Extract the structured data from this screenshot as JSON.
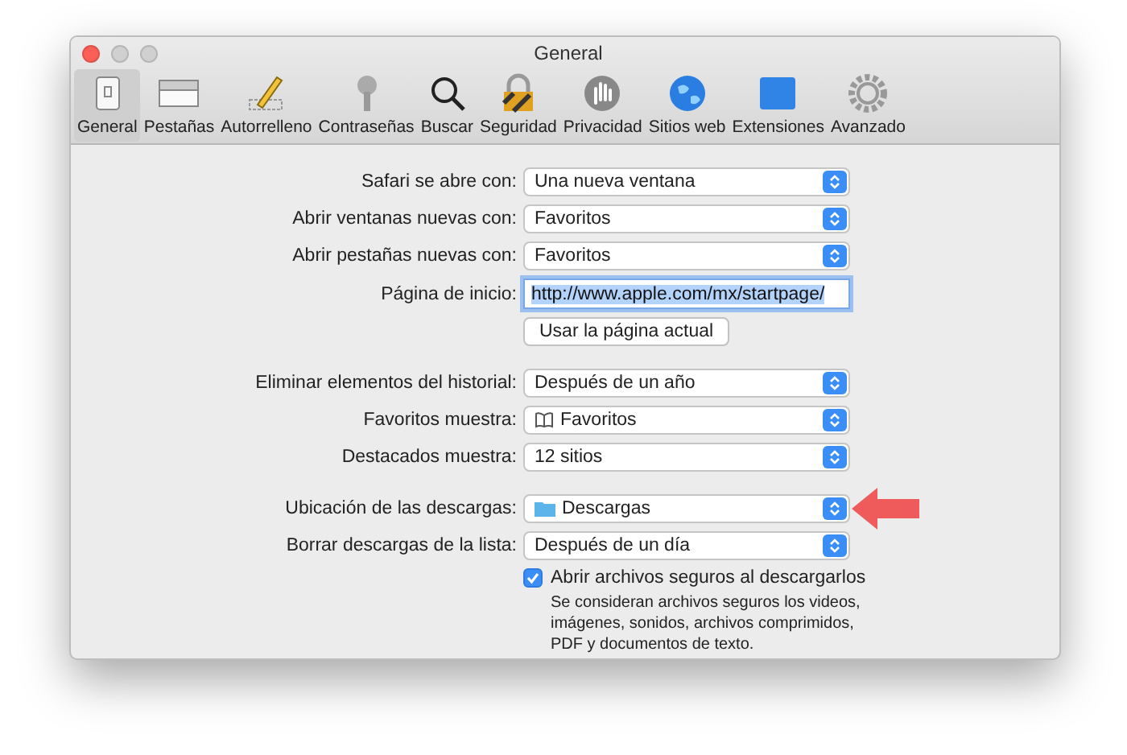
{
  "window": {
    "title": "General"
  },
  "toolbar": [
    {
      "label": "General",
      "selected": true
    },
    {
      "label": "Pestañas",
      "selected": false
    },
    {
      "label": "Autorrelleno",
      "selected": false
    },
    {
      "label": "Contraseñas",
      "selected": false
    },
    {
      "label": "Buscar",
      "selected": false
    },
    {
      "label": "Seguridad",
      "selected": false
    },
    {
      "label": "Privacidad",
      "selected": false
    },
    {
      "label": "Sitios web",
      "selected": false
    },
    {
      "label": "Extensiones",
      "selected": false
    },
    {
      "label": "Avanzado",
      "selected": false
    }
  ],
  "sections": [
    {
      "rows": [
        {
          "kind": "popup",
          "label": "Safari se abre con:",
          "value": "Una nueva ventana"
        },
        {
          "kind": "popup",
          "label": "Abrir ventanas nuevas con:",
          "value": "Favoritos"
        },
        {
          "kind": "popup",
          "label": "Abrir pestañas nuevas con:",
          "value": "Favoritos"
        },
        {
          "kind": "field",
          "label": "Página de inicio:",
          "value": "http://www.apple.com/mx/startpage/"
        },
        {
          "kind": "button",
          "value": "Usar la página actual"
        }
      ]
    },
    {
      "rows": [
        {
          "kind": "popup",
          "label": "Eliminar elementos del historial:",
          "value": "Después de un año"
        },
        {
          "kind": "bookpopup",
          "label": "Favoritos muestra:",
          "value": "Favoritos"
        },
        {
          "kind": "popup",
          "label": "Destacados muestra:",
          "value": "12 sitios"
        }
      ]
    },
    {
      "rows": [
        {
          "kind": "folderpopup",
          "label": "Ubicación de las descargas:",
          "value": "Descargas",
          "highlighted": true
        },
        {
          "kind": "popup",
          "label": "Borrar descargas de la lista:",
          "value": "Después de un día"
        },
        {
          "kind": "checkbox",
          "value": "Abrir archivos seguros al descargarlos",
          "checked": true,
          "note": "Se consideran archivos seguros los videos, imágenes, sonidos, archivos comprimidos, PDF y documentos de texto."
        }
      ]
    }
  ]
}
